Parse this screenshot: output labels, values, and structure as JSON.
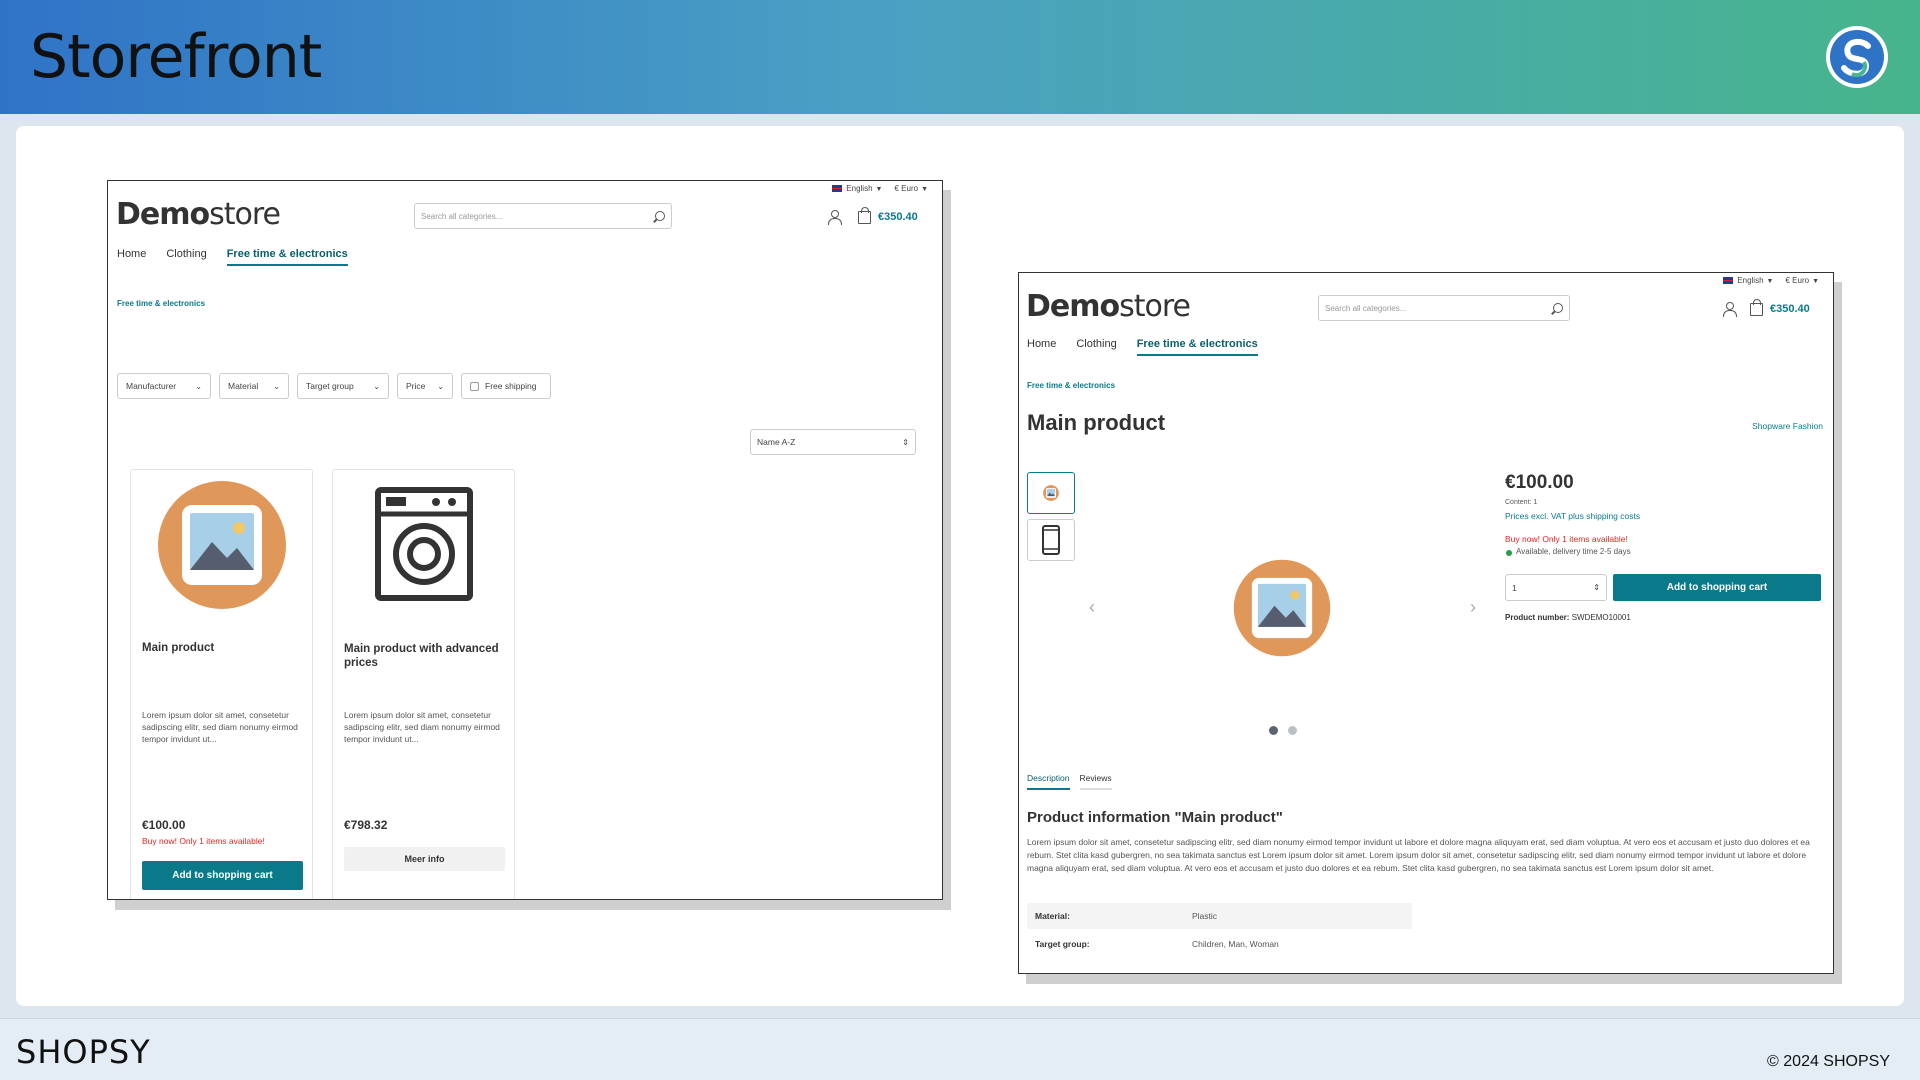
{
  "header": {
    "title": "Storefront"
  },
  "footer": {
    "brand": "SHOPSY",
    "copyright": "© 2024 SHOPSY"
  },
  "store": {
    "language": "English",
    "currency": "€ Euro",
    "brand_bold": "Demo",
    "brand_light": "store",
    "search_placeholder": "Search all categories...",
    "cart_total": "€350.40",
    "nav": [
      "Home",
      "Clothing",
      "Free time & electronics"
    ]
  },
  "listing": {
    "breadcrumb": "Free time & electronics",
    "filters": [
      "Manufacturer",
      "Material",
      "Target group",
      "Price"
    ],
    "free_shipping": "Free shipping",
    "sort": "Name A-Z",
    "products": [
      {
        "name": "Main product",
        "description": "Lorem ipsum dolor sit amet, consetetur sadipscing elitr, sed diam nonumy eirmod tempor invidunt ut...",
        "price": "€100.00",
        "stock": "Buy now! Only 1 items available!",
        "button": "Add to shopping cart"
      },
      {
        "name": "Main product with advanced prices",
        "description": "Lorem ipsum dolor sit amet, consetetur sadipscing elitr, sed diam nonumy eirmod tempor invidunt ut...",
        "price": "€798.32",
        "button": "Meer info"
      }
    ]
  },
  "detail": {
    "breadcrumb": "Free time & electronics",
    "title": "Main product",
    "manufacturer": "Shopware Fashion",
    "price": "€100.00",
    "content": "Content: 1",
    "tax_note": "Prices excl. VAT plus shipping costs",
    "stock": "Buy now! Only 1 items available!",
    "delivery": "Available, delivery time 2-5 days",
    "quantity": "1",
    "add_button": "Add to shopping cart",
    "product_number_label": "Product number:",
    "product_number": "SWDEMO10001",
    "tabs": [
      "Description",
      "Reviews"
    ],
    "info_title": "Product information \"Main product\"",
    "info_desc": "Lorem ipsum dolor sit amet, consetetur sadipscing elitr, sed diam nonumy eirmod tempor invidunt ut labore et dolore magna aliquyam erat, sed diam voluptua. At vero eos et accusam et justo duo dolores et ea rebum. Stet clita kasd gubergren, no sea takimata sanctus est Lorem ipsum dolor sit amet. Lorem ipsum dolor sit amet, consetetur sadipscing elitr, sed diam nonumy eirmod tempor invidunt ut labore et dolore magna aliquyam erat, sed diam voluptua. At vero eos et accusam et justo duo dolores et ea rebum. Stet clita kasd gubergren, no sea takimata sanctus est Lorem ipsum dolor sit amet.",
    "properties": [
      {
        "key": "Material:",
        "value": "Plastic"
      },
      {
        "key": "Target group:",
        "value": "Children, Man, Woman"
      }
    ]
  },
  "colors": {
    "accent": "#0a7a8a",
    "placeholder_orange": "#e0975a",
    "alert": "#e22222"
  }
}
